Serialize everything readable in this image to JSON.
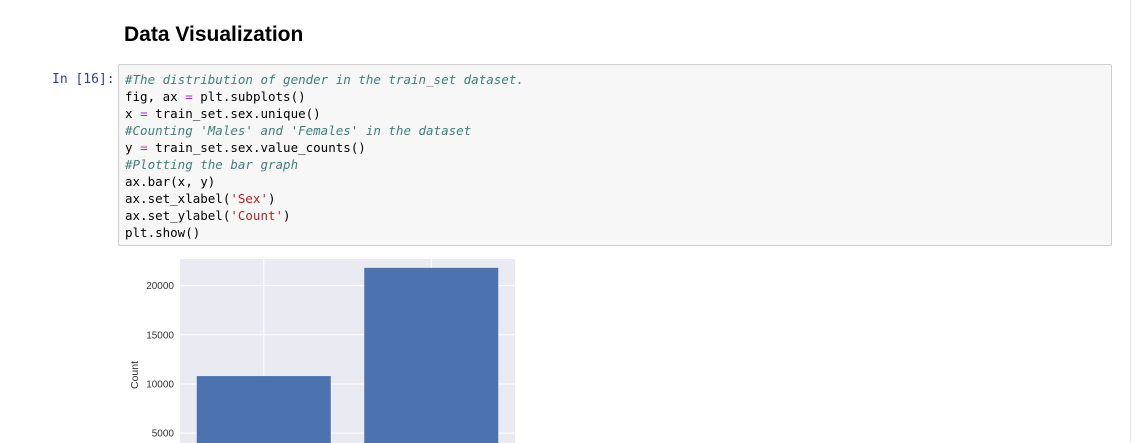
{
  "markdown": {
    "heading": "Data Visualization"
  },
  "cell": {
    "prompt": "In [16]:",
    "lines": [
      [
        {
          "t": "#The distribution of gender in the train_set dataset.",
          "k": "comment"
        }
      ],
      [
        {
          "t": "fig, ax ",
          "k": "plain"
        },
        {
          "t": "=",
          "k": "op"
        },
        {
          "t": " plt.subplots()",
          "k": "plain"
        }
      ],
      [
        {
          "t": "x ",
          "k": "plain"
        },
        {
          "t": "=",
          "k": "op"
        },
        {
          "t": " train_set.sex.unique()",
          "k": "plain"
        }
      ],
      [
        {
          "t": "#Counting 'Males' and 'Females' in the dataset",
          "k": "comment"
        }
      ],
      [
        {
          "t": "y ",
          "k": "plain"
        },
        {
          "t": "=",
          "k": "op"
        },
        {
          "t": " train_set.sex.value_counts()",
          "k": "plain"
        }
      ],
      [
        {
          "t": "#Plotting the bar graph",
          "k": "comment"
        }
      ],
      [
        {
          "t": "ax.bar(x, y)",
          "k": "plain"
        }
      ],
      [
        {
          "t": "ax.set_xlabel(",
          "k": "plain"
        },
        {
          "t": "'Sex'",
          "k": "str"
        },
        {
          "t": ")",
          "k": "plain"
        }
      ],
      [
        {
          "t": "ax.set_ylabel(",
          "k": "plain"
        },
        {
          "t": "'Count'",
          "k": "str"
        },
        {
          "t": ")",
          "k": "plain"
        }
      ],
      [
        {
          "t": "plt.show()",
          "k": "plain"
        }
      ]
    ]
  },
  "chart_data": {
    "type": "bar",
    "ylabel": "Count",
    "yticks": [
      5000,
      10000,
      15000,
      20000
    ],
    "ytick_labels": [
      "5000",
      "10000",
      "15000",
      "20000"
    ],
    "values": [
      10800,
      21800
    ],
    "ylim_visible": [
      4000,
      22700
    ],
    "grid": true,
    "bar_color": "#4c72b0",
    "axes_bg": "#eaeaf2"
  },
  "colors": {
    "prompt": "#303f9f",
    "comment": "#408080",
    "operator": "#aa22ff",
    "string": "#ba2121"
  }
}
